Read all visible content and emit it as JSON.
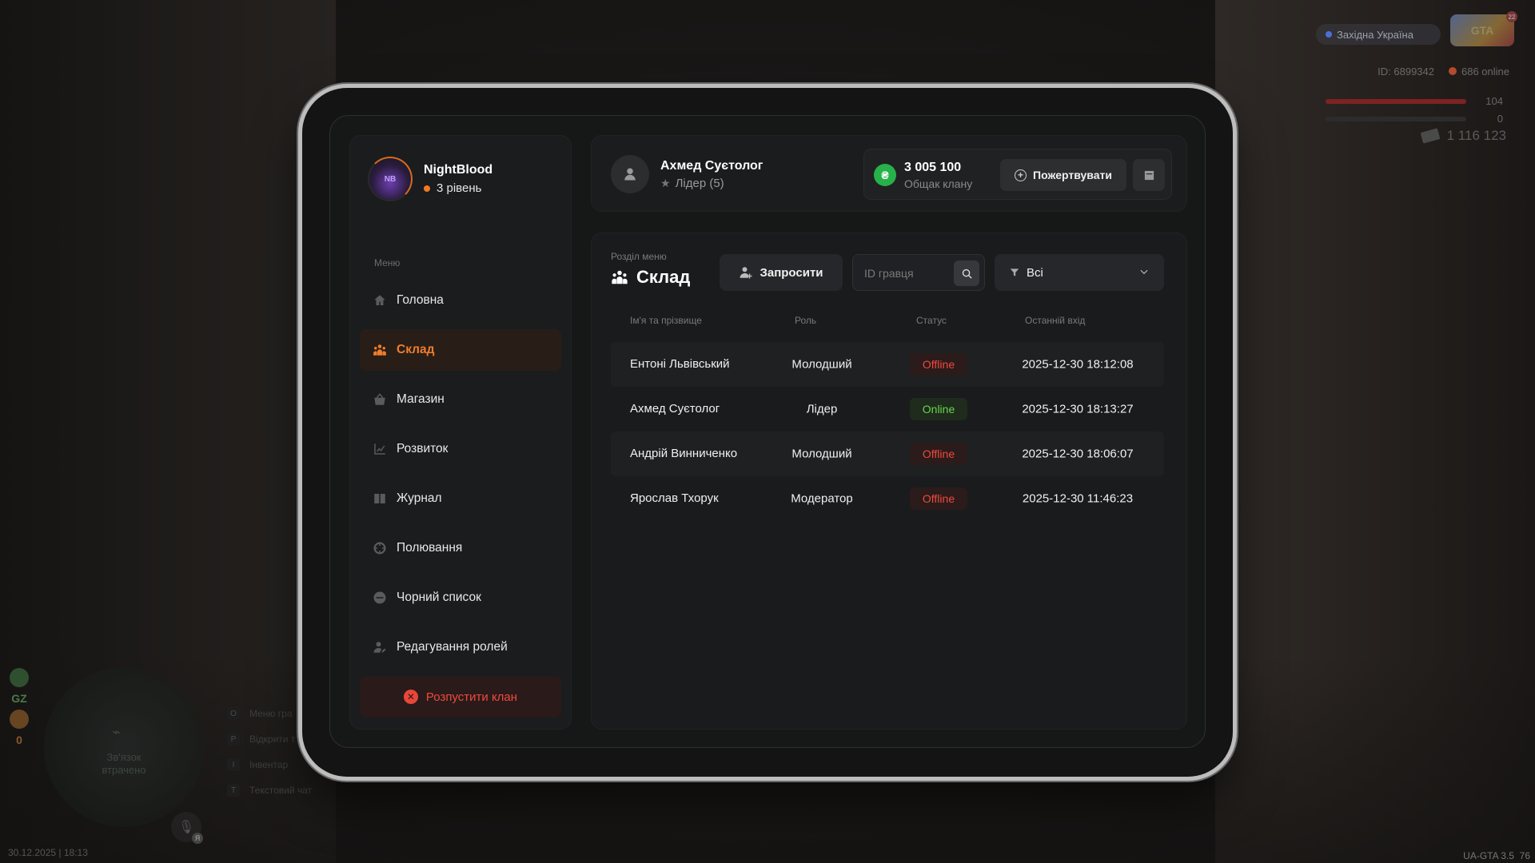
{
  "hud": {
    "server": "Західна Україна",
    "logo_text": "GTA",
    "logo_badge": "22",
    "player_id": "ID: 6899342",
    "online": "686 online",
    "health": "104",
    "armor": "0",
    "money": "1 116 123",
    "gz_label": "GZ",
    "gz_value": "0",
    "minimap_status": "Зв'язок втрачено",
    "keyhints": [
      {
        "key": "O",
        "label": "Меню гра"
      },
      {
        "key": "P",
        "label": "Відкрити т"
      },
      {
        "key": "I",
        "label": "Інвентар"
      },
      {
        "key": "T",
        "label": "Текстовий чат"
      }
    ],
    "mic_badge": "Я",
    "datetime": "30.12.2025 | 18:13",
    "version": "UA-GTA 3.5",
    "fps": "76"
  },
  "profile": {
    "name": "NightBlood",
    "level": "3 рівень",
    "avatar_text": "NB"
  },
  "menu": {
    "label": "Меню",
    "items": [
      {
        "label": "Головна",
        "icon": "home-icon",
        "active": false
      },
      {
        "label": "Склад",
        "icon": "members-icon",
        "active": true
      },
      {
        "label": "Магазин",
        "icon": "basket-icon",
        "active": false
      },
      {
        "label": "Розвиток",
        "icon": "chart-icon",
        "active": false
      },
      {
        "label": "Журнал",
        "icon": "book-icon",
        "active": false
      },
      {
        "label": "Полювання",
        "icon": "crosshair-icon",
        "active": false
      },
      {
        "label": "Чорний список",
        "icon": "block-icon",
        "active": false
      },
      {
        "label": "Редагування ролей",
        "icon": "user-edit-icon",
        "active": false
      }
    ],
    "disband_label": "Розпустити клан"
  },
  "header": {
    "leader_name": "Ахмед Суєтолог",
    "leader_role": "Лідер (5)",
    "bank_amount": "3 005 100",
    "bank_label": "Общак клану",
    "bank_currency_symbol": "₴",
    "donate_label": "Пожертвувати"
  },
  "section": {
    "label": "Розділ меню",
    "title": "Склад",
    "invite_label": "Запросити",
    "search_placeholder": "ID гравця",
    "filter_value": "Всі"
  },
  "table": {
    "headers": {
      "name": "Ім'я та прізвище",
      "role": "Роль",
      "status": "Статус",
      "last_login": "Останній вхід"
    },
    "rows": [
      {
        "name": "Ентоні Львівський",
        "role": "Молодший",
        "status": "Offline",
        "last_login": "2025-12-30 18:12:08"
      },
      {
        "name": "Ахмед Суєтолог",
        "role": "Лідер",
        "status": "Online",
        "last_login": "2025-12-30 18:13:27"
      },
      {
        "name": "Андрій Винниченко",
        "role": "Молодший",
        "status": "Offline",
        "last_login": "2025-12-30 18:06:07"
      },
      {
        "name": "Ярослав Тхорук",
        "role": "Модератор",
        "status": "Offline",
        "last_login": "2025-12-30 11:46:23"
      }
    ]
  },
  "colors": {
    "accent": "#f07d2c",
    "online": "#67d64a",
    "offline": "#ee4a3c",
    "bank_coin": "#27b14a"
  }
}
